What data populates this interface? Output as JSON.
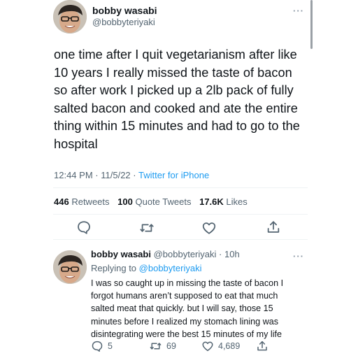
{
  "tweet": {
    "display_name": "bobby wasabi",
    "handle": "@bobbyteriyaki",
    "text": "one time after I quit vegetarianism after like 10 years I really missed the taste of bacon so after work I picked up a 2lb pack of fully salted bacon and cooked and ate the entire thing within 15 minutes and had to go to the hospital",
    "time": "12:44 PM",
    "date": "11/5/22",
    "source": "Twitter for iPhone",
    "retweets_count": "446",
    "retweets_label": "Retweets",
    "quotes_count": "100",
    "quotes_label": "Quote Tweets",
    "likes_count": "17.6K",
    "likes_label": "Likes",
    "more": "···"
  },
  "reply": {
    "display_name": "bobby wasabi",
    "handle": "@bobbyteriyaki",
    "age": "10h",
    "replying_prefix": "Replying to",
    "replying_to": "@bobbyteriyaki",
    "text": "I was so caught up in missing the taste of bacon I forgot humans aren’t supposed to eat that much salted meat that quickly. but I will say, those 15 minutes before I realized my stomach lining was disintegrating were the best 15 minutes of my life",
    "reply_count": "5",
    "retweet_count": "69",
    "like_count": "4,689",
    "more": "···"
  },
  "separators": {
    "dot": "·"
  },
  "icons": {
    "reply": "reply-icon",
    "retweet": "retweet-icon",
    "like": "heart-icon",
    "share": "share-icon",
    "more": "more-icon"
  },
  "colors": {
    "text": "#0f1419",
    "secondary": "#536471",
    "link": "#1d9bf0",
    "divider": "#eff3f4"
  }
}
